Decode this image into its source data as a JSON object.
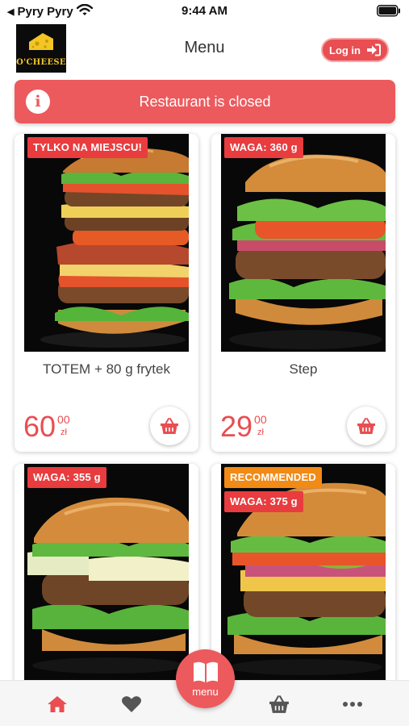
{
  "status_bar": {
    "back_arrow": "◀",
    "carrier": "Pyry Pyry",
    "time": "9:44 AM"
  },
  "header": {
    "logo_text": "O'CHEESE",
    "title": "Menu",
    "login_label": "Log in"
  },
  "banner": {
    "text": "Restaurant is closed"
  },
  "products": [
    {
      "badges": [
        "TYLKO NA MIEJSCU!"
      ],
      "name": "TOTEM + 80 g frytek",
      "price_main": "60",
      "price_cents": "00",
      "currency": "zł"
    },
    {
      "badges": [
        "WAGA: 360 g"
      ],
      "name": "Step",
      "price_main": "29",
      "price_cents": "00",
      "currency": "zł"
    },
    {
      "badges": [
        "WAGA: 355 g"
      ]
    },
    {
      "badges": [
        "RECOMMENDED",
        "WAGA: 375 g"
      ]
    }
  ],
  "tab_bar": {
    "menu_label": "menu",
    "active_tab": "home"
  },
  "colors": {
    "accent": "#E84E52",
    "badge_red": "#E83C3F",
    "badge_orange": "#F28A16",
    "icon_gray": "#555555"
  }
}
